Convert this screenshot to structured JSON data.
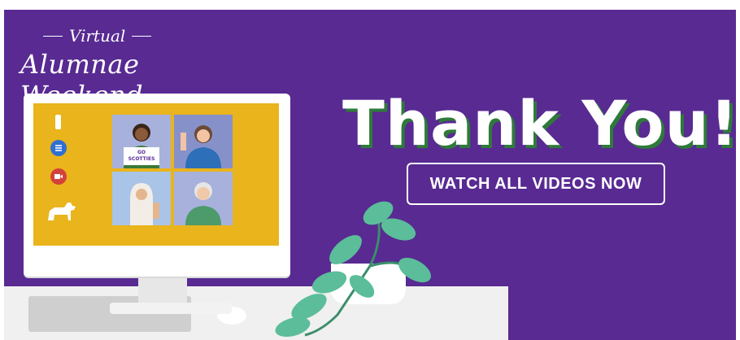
{
  "brand": {
    "subtitle": "Virtual",
    "title": "Alumnae Weekend"
  },
  "headline": "Thank You!",
  "cta": {
    "label": "WATCH ALL VIDEOS NOW"
  },
  "illustration": {
    "sign_text": "GO SCOTTIES"
  },
  "colors": {
    "background": "#582a92",
    "screen": "#e9b41c",
    "plant": "#5bbd99",
    "text": "#ffffff"
  },
  "icons": [
    "list-icon",
    "camera-icon",
    "scottie-dog-icon",
    "video-tile-icons"
  ]
}
